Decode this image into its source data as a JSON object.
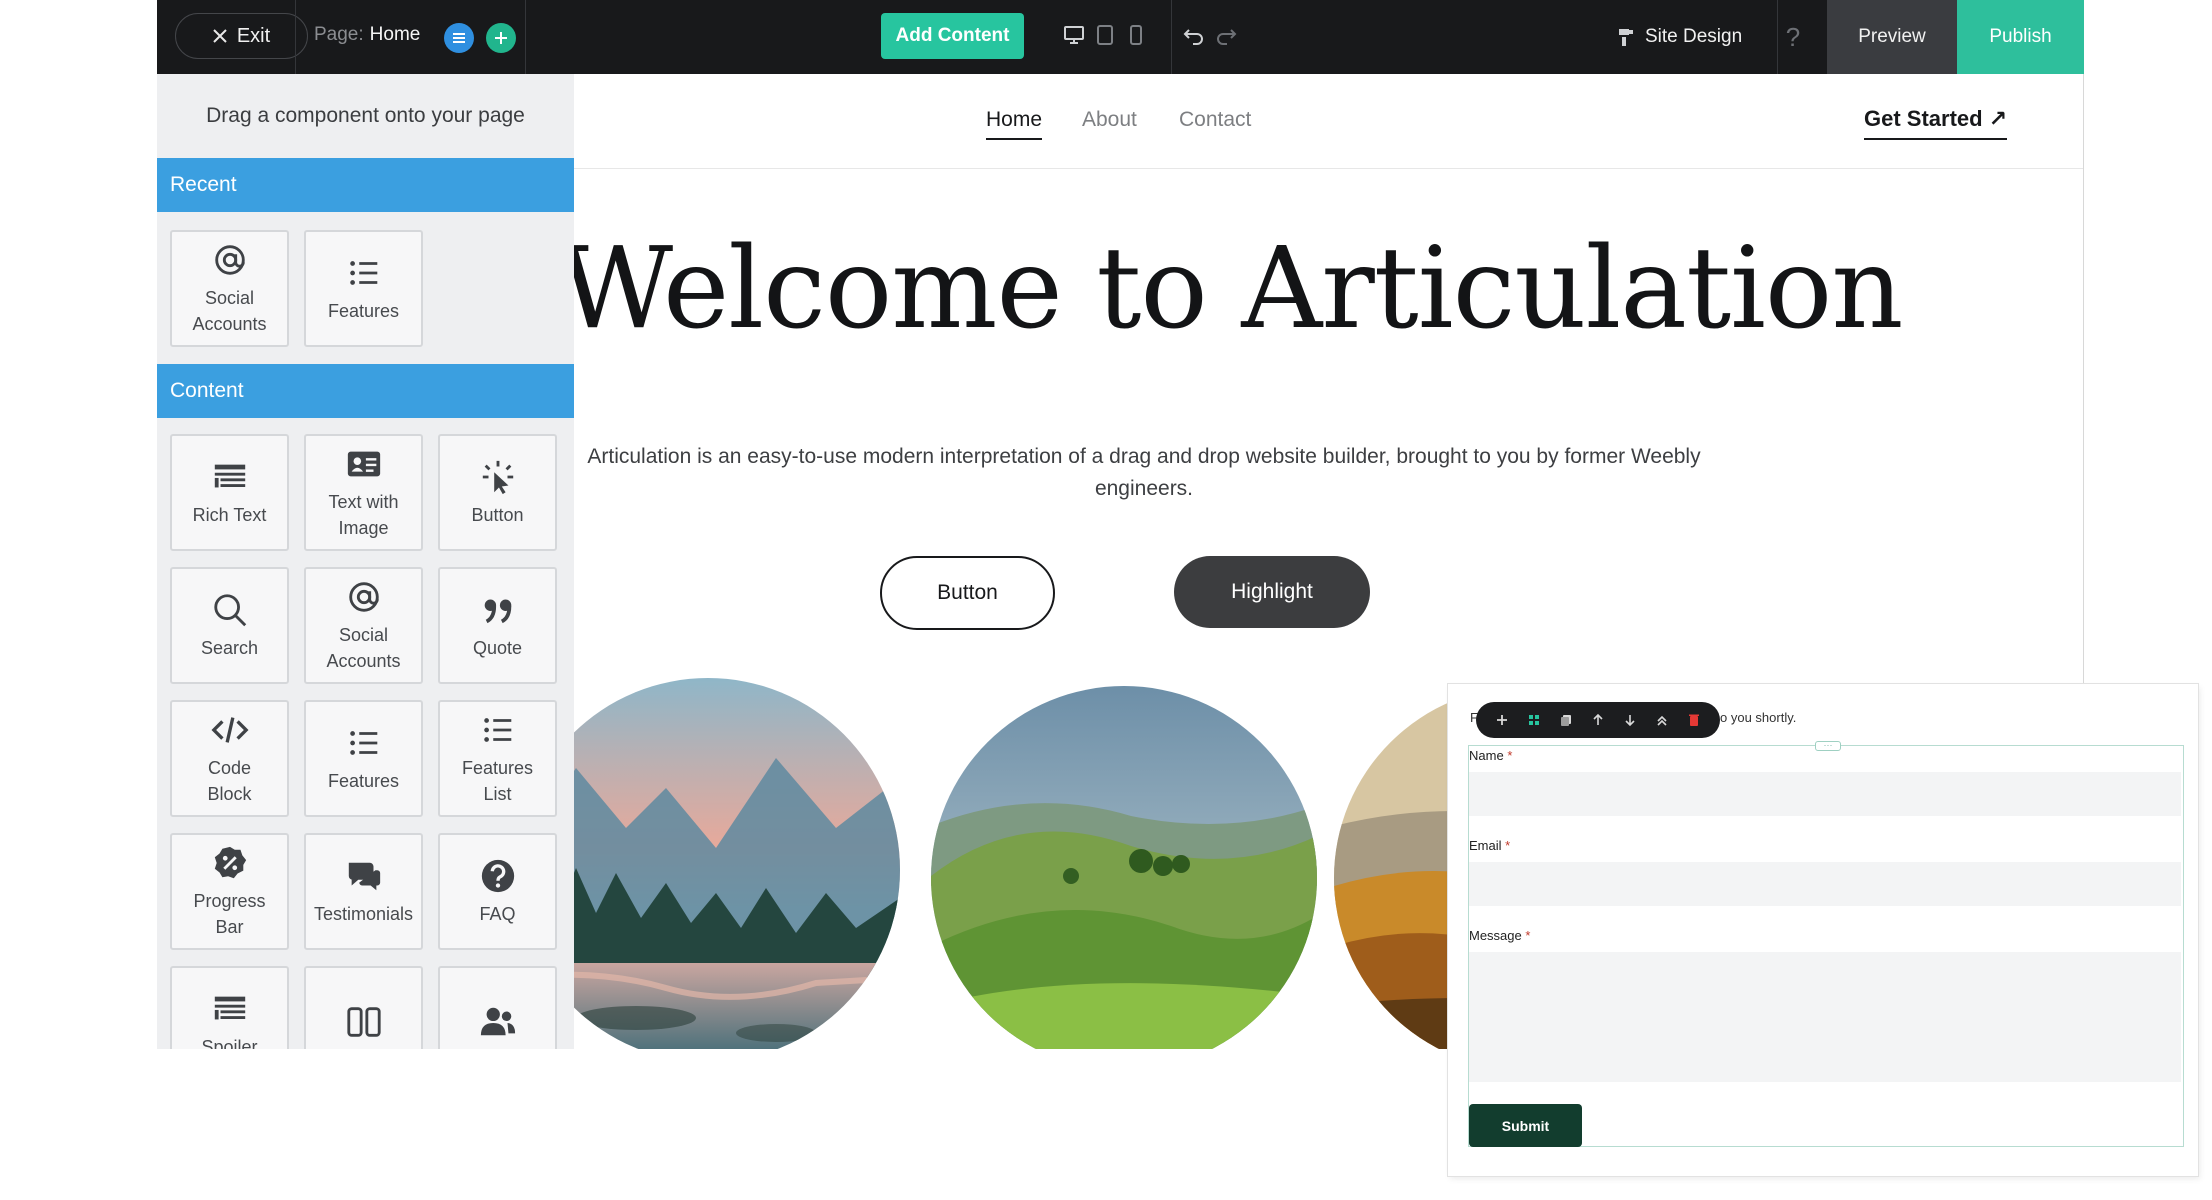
{
  "toolbar": {
    "exit_label": "Exit",
    "page_prefix": "Page:",
    "page_name": "Home",
    "add_content_label": "Add Content",
    "site_design_label": "Site Design",
    "help_label": "?",
    "preview_label": "Preview",
    "publish_label": "Publish"
  },
  "panel": {
    "hint": "Drag a component onto your page",
    "sections": [
      {
        "title": "Recent",
        "items": [
          {
            "label": "Social\nAccounts",
            "icon": "at-icon"
          },
          {
            "label": "Features",
            "icon": "list-icon"
          }
        ]
      },
      {
        "title": "Content",
        "items": [
          {
            "label": "Rich Text",
            "icon": "rich-text-icon"
          },
          {
            "label": "Text with\nImage",
            "icon": "id-card-icon"
          },
          {
            "label": "Button",
            "icon": "click-pointer-icon"
          },
          {
            "label": "Search",
            "icon": "search-icon"
          },
          {
            "label": "Social\nAccounts",
            "icon": "at-icon"
          },
          {
            "label": "Quote",
            "icon": "quote-icon"
          },
          {
            "label": "Code\nBlock",
            "icon": "code-icon"
          },
          {
            "label": "Features",
            "icon": "list-icon"
          },
          {
            "label": "Features\nList",
            "icon": "list-icon"
          },
          {
            "label": "Progress\nBar",
            "icon": "percent-badge-icon"
          },
          {
            "label": "Testimonials",
            "icon": "speech-bubbles-icon"
          },
          {
            "label": "FAQ",
            "icon": "question-circle-icon"
          },
          {
            "label": "Spoiler",
            "icon": "rich-text-icon"
          },
          {
            "label": "",
            "icon": "columns-icon"
          },
          {
            "label": "",
            "icon": "users-icon"
          }
        ]
      }
    ]
  },
  "site": {
    "nav": [
      {
        "label": "Home",
        "active": true
      },
      {
        "label": "About",
        "active": false
      },
      {
        "label": "Contact",
        "active": false
      }
    ],
    "cta_label": "Get Started",
    "cta_arrow": "↗",
    "hero_title": "Welcome to Articulation",
    "hero_text": "Articulation is an easy-to-use modern interpretation of a drag and drop website builder, brought to you by former Weebly engineers.",
    "button_label": "Button",
    "highlight_label": "Highlight"
  },
  "form": {
    "intro_start": "F",
    "intro_end": "o you shortly.",
    "fields": [
      {
        "label": "Name",
        "required": "*"
      },
      {
        "label": "Email",
        "required": "*"
      },
      {
        "label": "Message",
        "required": "*"
      }
    ],
    "submit_label": "Submit",
    "toolbar_icons": [
      "plus-icon",
      "grid-icon",
      "copy-icon",
      "arrow-up-icon",
      "arrow-down-icon",
      "double-chevron-up-icon",
      "delete-icon"
    ]
  },
  "colors": {
    "accent_teal": "#27c59f",
    "accent_blue": "#3b9fe0",
    "dark": "#18191b",
    "submit": "#123d2e"
  }
}
